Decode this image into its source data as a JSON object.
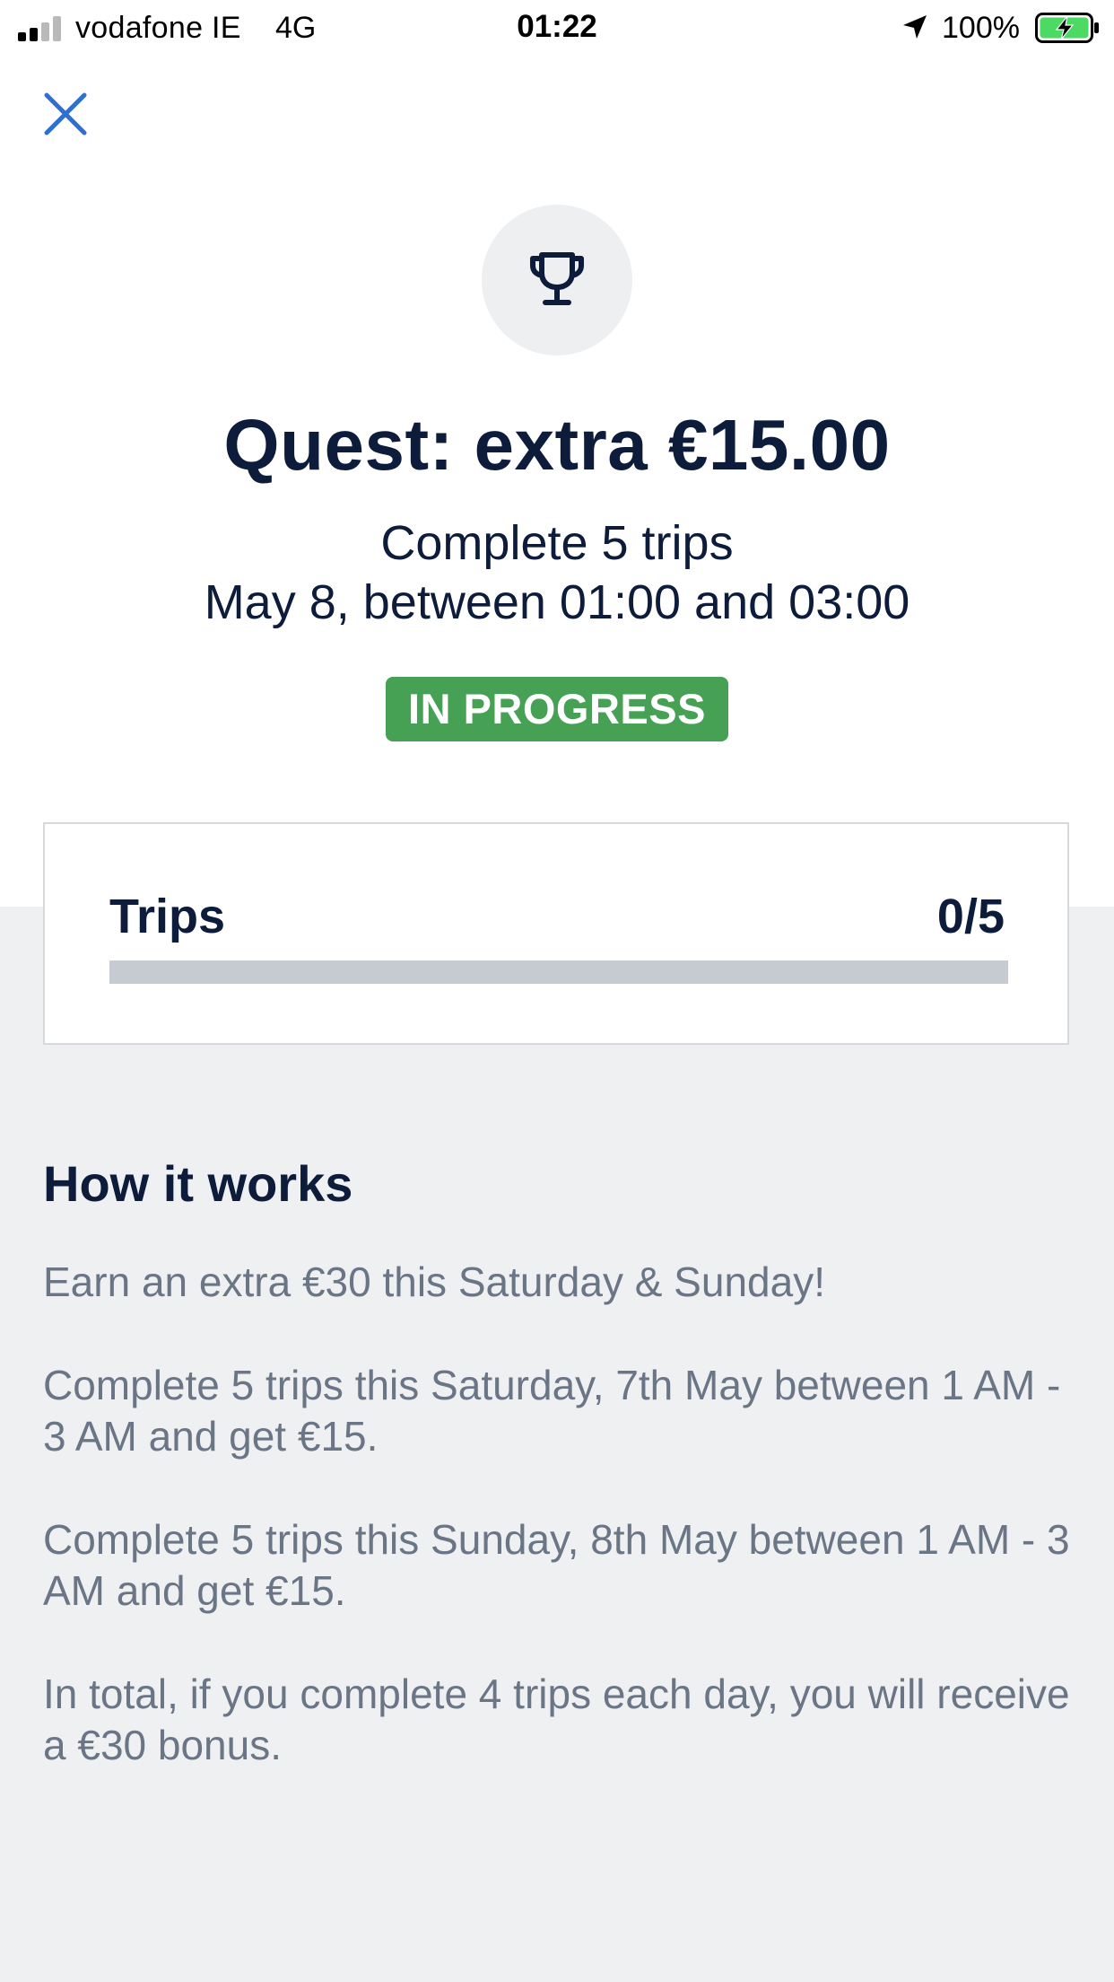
{
  "status_bar": {
    "carrier": "vodafone IE",
    "network": "4G",
    "time": "01:22",
    "battery": "100%",
    "signal_bars_active": 2,
    "signal_bars_total": 4
  },
  "header": {
    "close_icon": "close-icon",
    "trophy_icon": "trophy-icon"
  },
  "quest": {
    "title": "Quest: extra €15.00",
    "subtitle_line1": "Complete 5 trips",
    "subtitle_line2": "May 8, between 01:00 and 03:00",
    "status": "IN PROGRESS"
  },
  "progress": {
    "label": "Trips",
    "count": "0/5",
    "fraction": 0
  },
  "how_it_works": {
    "title": "How it works",
    "paragraphs": [
      "Earn an extra €30 this Saturday & Sunday!",
      "Complete 5 trips this Saturday, 7th May between 1 AM - 3 AM and get €15.",
      "Complete 5 trips this Sunday, 8th May between 1 AM - 3 AM and get €15.",
      "In total, if you complete 4 trips each day, you will receive a €30 bonus."
    ]
  },
  "colors": {
    "primary_text": "#0c1c3a",
    "accent_blue": "#2f6fd1",
    "status_green": "#47a155",
    "body_grey": "#6a7585",
    "section_bg": "#eff0f2"
  }
}
